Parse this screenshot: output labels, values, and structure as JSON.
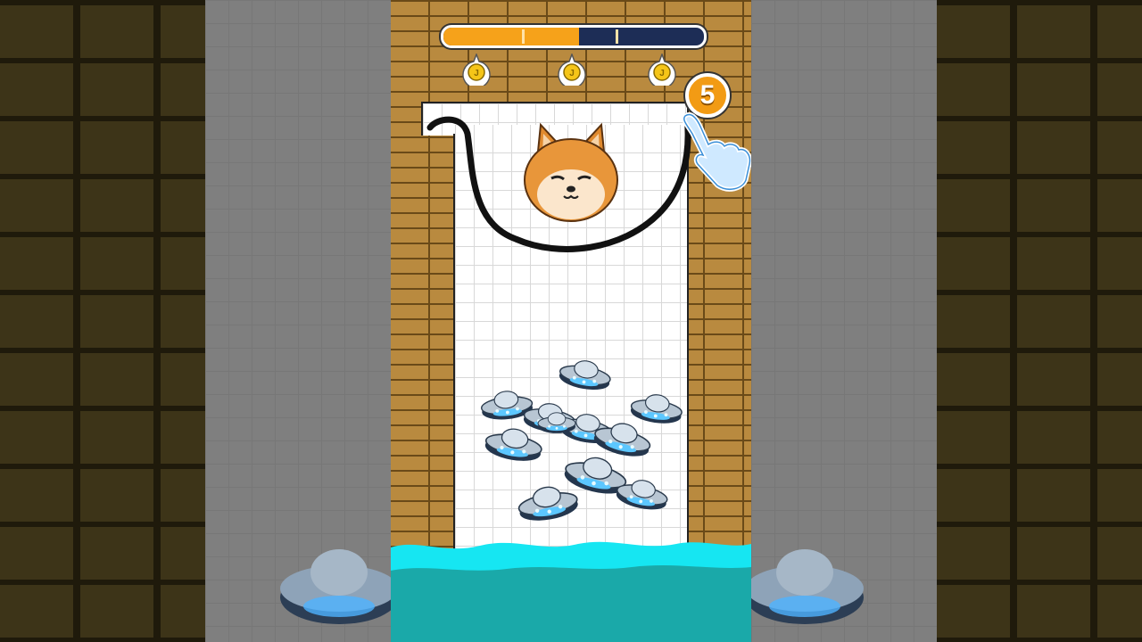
{
  "game": {
    "level_progress": 0.52,
    "progress_milestones": [
      0.3,
      0.66
    ],
    "stars": [
      "coin-star-icon",
      "coin-star-icon",
      "coin-star-icon"
    ],
    "ink_count": "5",
    "character": "shiba-dog-head",
    "enemies": "ufo-swarm",
    "ufo_count": 11
  },
  "colors": {
    "progress_fill": "#f6a21a",
    "progress_track": "#1d2d56",
    "badge": "#f29b14",
    "water_surface": "#16e6f2",
    "water_deep": "#1aa9a9",
    "brick": "#b98a3f"
  }
}
